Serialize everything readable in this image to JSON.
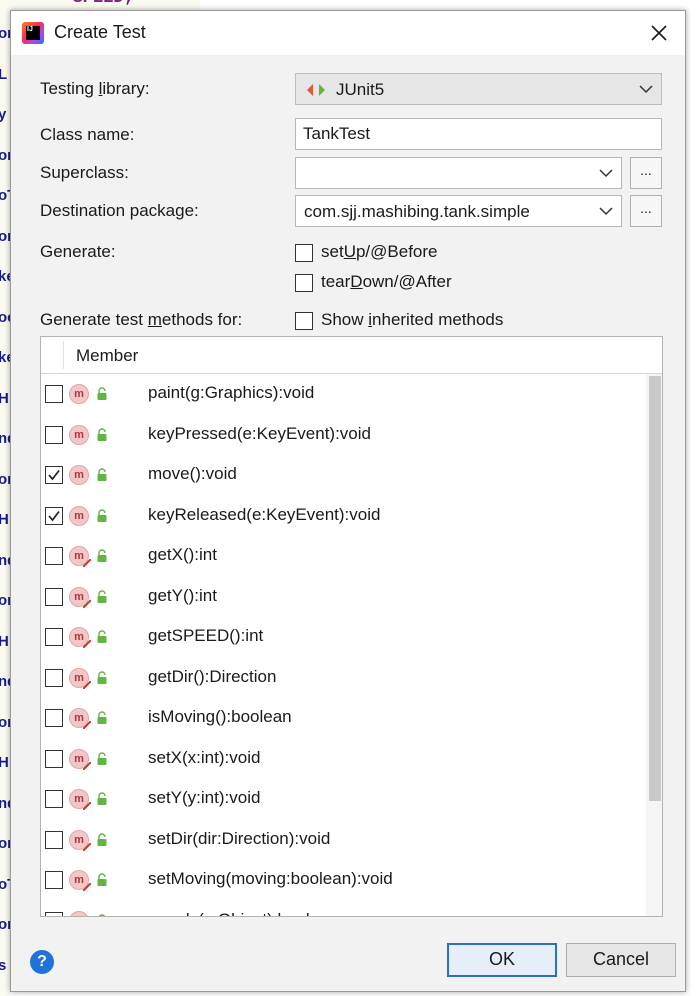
{
  "editor": {
    "top_code": "== SPEED;",
    "gutter": [
      "or",
      "L",
      "y",
      "or",
      "oT",
      "or",
      "ke",
      "oc",
      "ke",
      "H",
      "nd",
      "or",
      "H",
      "nd",
      "or",
      "H",
      "nd",
      "or",
      "H",
      "nd",
      "or",
      "oT",
      "or",
      "s"
    ]
  },
  "dialog": {
    "title": "Create Test",
    "testing_library": {
      "label_pre": "Testing ",
      "label_mn": "l",
      "label_post": "ibrary:",
      "value": "JUnit5"
    },
    "class_name": {
      "label": "Class name:",
      "value": "TankTest"
    },
    "superclass": {
      "label": "Superclass:",
      "value": "",
      "button": "..."
    },
    "destination_package": {
      "label": "Destination package:",
      "value": "com.sjj.mashibing.tank.simple",
      "button": "..."
    },
    "generate": {
      "label": "Generate:",
      "setup": {
        "pre": "set",
        "mn": "U",
        "post": "p/@Before",
        "checked": false
      },
      "teardown": {
        "pre": "tear",
        "mn": "D",
        "post": "own/@After",
        "checked": false
      }
    },
    "generate_methods": {
      "label_pre": "Generate test ",
      "label_mn": "m",
      "label_post": "ethods for:",
      "show_inherited": {
        "pre": "Show ",
        "mn": "i",
        "post": "nherited methods",
        "checked": false
      }
    },
    "table": {
      "header": "Member",
      "rows": [
        {
          "name": "paint(g:Graphics):void",
          "checked": false
        },
        {
          "name": "keyPressed(e:KeyEvent):void",
          "checked": false
        },
        {
          "name": "move():void",
          "checked": true
        },
        {
          "name": "keyReleased(e:KeyEvent):void",
          "checked": true
        },
        {
          "name": "getX():int",
          "checked": false
        },
        {
          "name": "getY():int",
          "checked": false
        },
        {
          "name": "getSPEED():int",
          "checked": false
        },
        {
          "name": "getDir():Direction",
          "checked": false
        },
        {
          "name": "isMoving():boolean",
          "checked": false
        },
        {
          "name": "setX(x:int):void",
          "checked": false
        },
        {
          "name": "setY(y:int):void",
          "checked": false
        },
        {
          "name": "setDir(dir:Direction):void",
          "checked": false
        },
        {
          "name": "setMoving(moving:boolean):void",
          "checked": false
        },
        {
          "name": "equals(o:Object):boolean",
          "checked": false
        }
      ]
    },
    "buttons": {
      "ok": "OK",
      "cancel": "Cancel",
      "help": "?"
    }
  },
  "colors": {
    "accent": "#2f6fbf",
    "method_icon": "#f2c7c7",
    "lock_green": "#62b543",
    "help_blue": "#1f73d8"
  }
}
